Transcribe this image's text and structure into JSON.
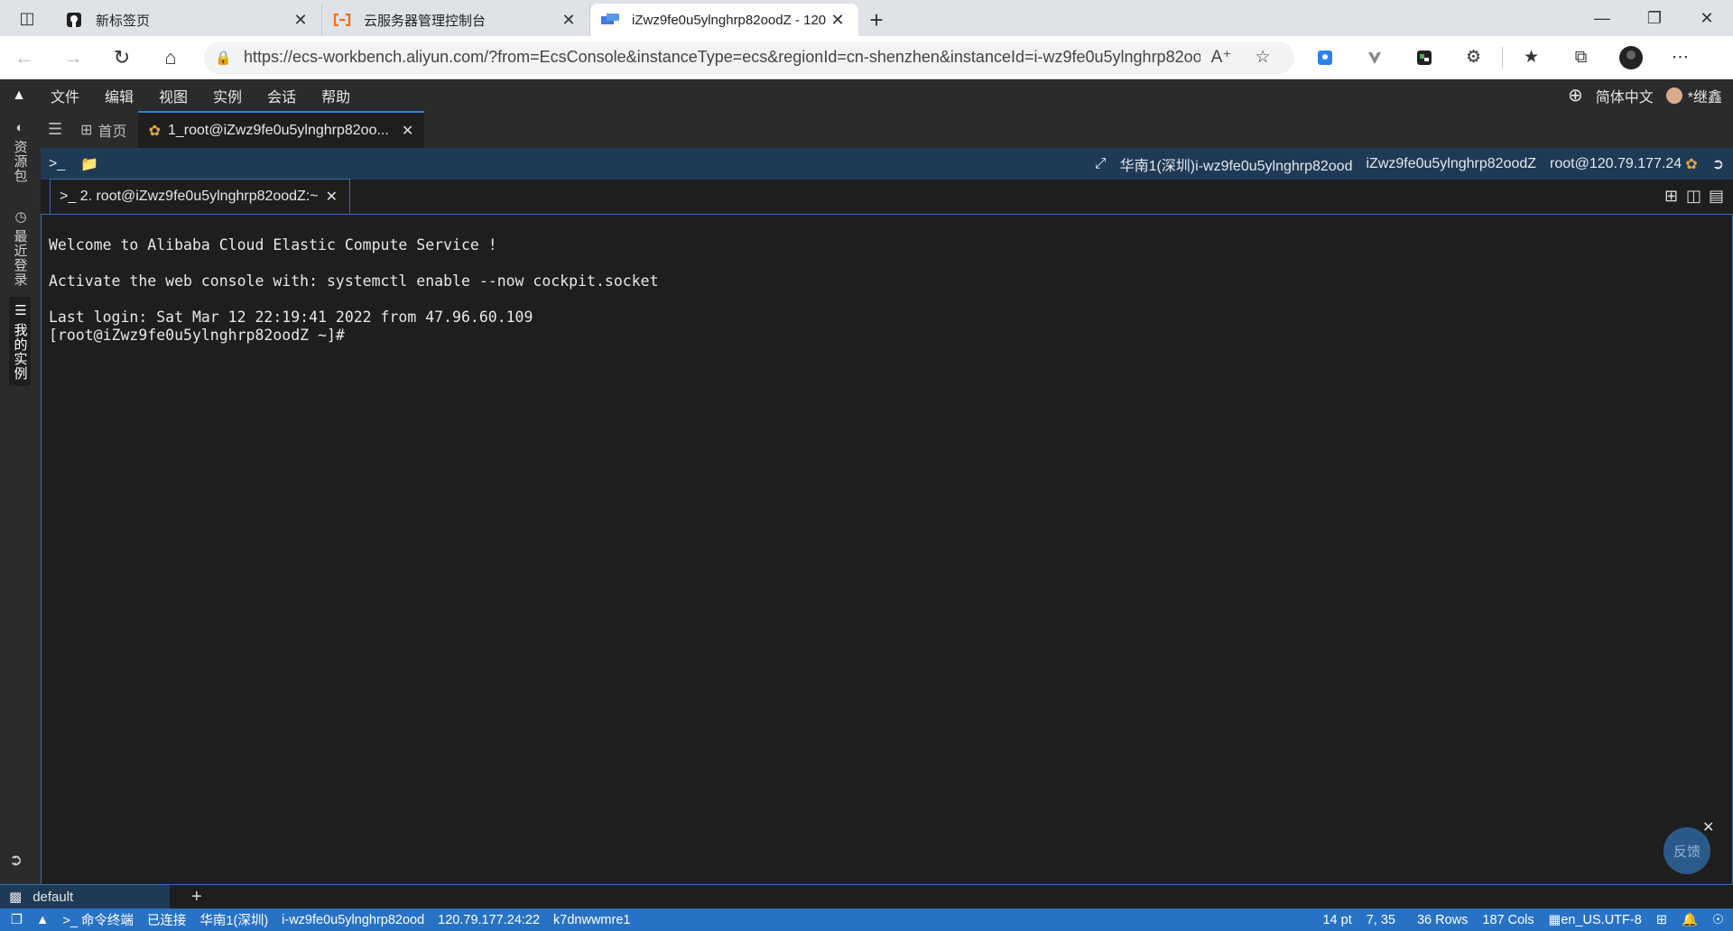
{
  "browser": {
    "tabs": [
      {
        "title": "新标签页",
        "icon": "github-icon"
      },
      {
        "title": "云服务器管理控制台",
        "icon": "aliyun-icon"
      },
      {
        "title": "iZwz9fe0u5ylnghrp82oodZ - 120",
        "icon": "terminal-favicon",
        "active": true
      }
    ],
    "url": "https://ecs-workbench.aliyun.com/?from=EcsConsole&instanceType=ecs&regionId=cn-shenzhen&instanceId=i-wz9fe0u5ylnghrp82ood..."
  },
  "workbench": {
    "menu": [
      "文件",
      "编辑",
      "视图",
      "实例",
      "会话",
      "帮助"
    ],
    "language": "简体中文",
    "user": "*继鑫",
    "sidebar": {
      "items": [
        {
          "label": "资源包",
          "icon": "package-icon"
        },
        {
          "label": "最近登录",
          "icon": "clock-icon"
        },
        {
          "label": "我的实例",
          "icon": "list-icon"
        }
      ]
    },
    "tabs": {
      "home": "首页",
      "session": "1_root@iZwz9fe0u5ylnghrp82oo..."
    },
    "session_info": {
      "instance": "华南1(深圳)i-wz9fe0u5ylnghrp82ood",
      "hostname": "iZwz9fe0u5ylnghrp82oodZ",
      "login": "root@120.79.177.24"
    },
    "terminal_tab": ">_ 2. root@iZwz9fe0u5ylnghrp82oodZ:~",
    "terminal_lines": [
      "Welcome to Alibaba Cloud Elastic Compute Service !",
      "",
      "Activate the web console with: systemctl enable --now cockpit.socket",
      "",
      "Last login: Sat Mar 12 22:19:41 2022 from 47.96.60.109",
      "[root@iZwz9fe0u5ylnghrp82oodZ ~]#"
    ],
    "feedback": "反馈",
    "session_list": {
      "name": "default"
    },
    "status": {
      "terminal_label": "命令终端",
      "connection": "已连接",
      "region": "华南1(深圳)",
      "instance_id": "i-wz9fe0u5ylnghrp82ood",
      "address": "120.79.177.24:22",
      "session_id": "k7dnwwmre1",
      "font_size": "14 pt",
      "cursor": "7, 35",
      "rows": "36 Rows",
      "cols": "187 Cols",
      "encoding": "en_US.UTF-8"
    }
  }
}
